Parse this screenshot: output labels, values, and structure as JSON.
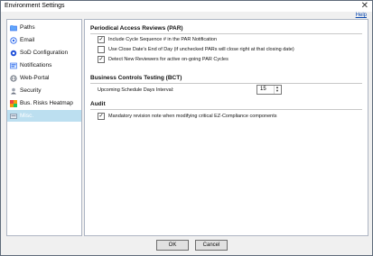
{
  "window": {
    "title": "Environment Settings",
    "help_label": "Help"
  },
  "sidebar": {
    "items": [
      {
        "label": "Paths",
        "icon": "folder-icon",
        "color": "#3b82f6",
        "selected": false
      },
      {
        "label": "Email",
        "icon": "at-icon",
        "color": "#2563eb",
        "selected": false
      },
      {
        "label": "SoD Configuration",
        "icon": "sod-icon",
        "color": "#1d4ed8",
        "selected": false
      },
      {
        "label": "Notifications",
        "icon": "notifications-icon",
        "color": "#2563eb",
        "selected": false
      },
      {
        "label": "Web-Portal",
        "icon": "globe-icon",
        "color": "#4b5563",
        "selected": false
      },
      {
        "label": "Security",
        "icon": "security-icon",
        "color": "#6b7280",
        "selected": false
      },
      {
        "label": "Bus. Risks Heatmap",
        "icon": "heatmap-icon",
        "color": "#ef4444",
        "selected": false
      },
      {
        "label": "Misc.",
        "icon": "misc-icon",
        "color": "#94a3b8",
        "selected": true
      }
    ]
  },
  "main": {
    "par": {
      "title": "Periodical Access Reviews (PAR)",
      "options": [
        {
          "label": "Include Cycle Sequence # in the PAR Notification",
          "checked": true
        },
        {
          "label": "Use Close Date's End of Day (if unchecked PARs will close right at that closing date)",
          "checked": false
        },
        {
          "label": "Detect New Reviewers for active on-going PAR Cycles",
          "checked": true
        }
      ]
    },
    "bct": {
      "title": "Business Controls Testing (BCT)",
      "interval_label": "Upcoming Schedule Days Interval:",
      "interval_value": "15"
    },
    "audit": {
      "title": "Audit",
      "options": [
        {
          "label": "Mandatory revision note when modifying critical EZ-Compliance components",
          "checked": true
        }
      ]
    }
  },
  "buttons": {
    "ok": "OK",
    "cancel": "Cancel"
  }
}
